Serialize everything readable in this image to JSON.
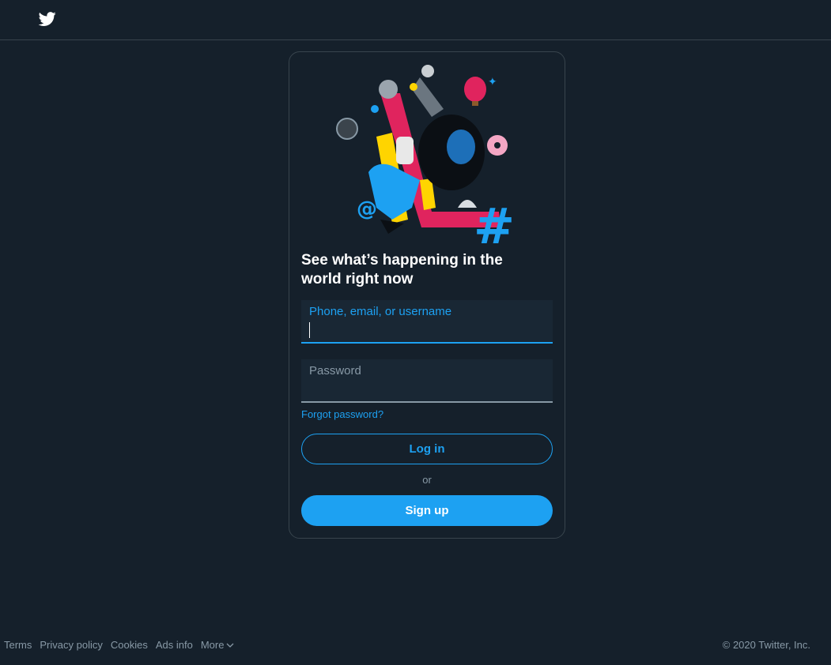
{
  "brand": {
    "logo_icon": "twitter-bird-icon",
    "accent_color": "#1da1f2",
    "background_color": "#15202b"
  },
  "login_card": {
    "hero_image": "collage-illustration",
    "headline": "See what’s happening in the world right now",
    "username_field": {
      "label": "Phone, email, or username",
      "value": ""
    },
    "password_field": {
      "label": "Password",
      "value": ""
    },
    "forgot_password": "Forgot password?",
    "login_button": "Log in",
    "or_text": "or",
    "signup_button": "Sign up"
  },
  "footer": {
    "links": [
      "Terms",
      "Privacy policy",
      "Cookies",
      "Ads info"
    ],
    "more_label": "More",
    "more_icon": "chevron-down-icon",
    "copyright": "© 2020 Twitter, Inc."
  }
}
